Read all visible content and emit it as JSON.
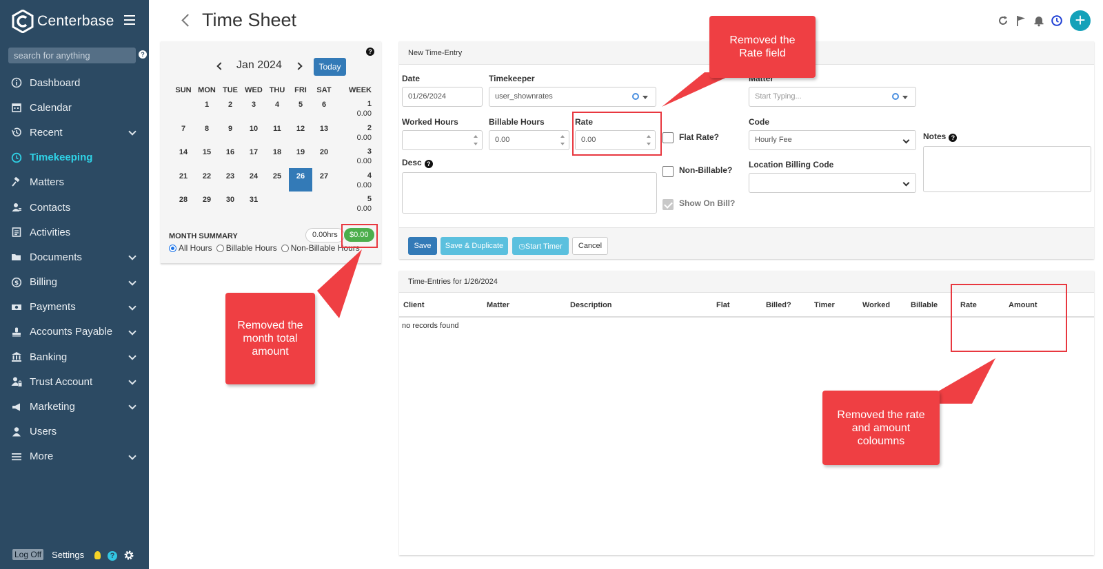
{
  "app": {
    "brand": "Centerbase",
    "search_placeholder": "search for anything",
    "help_glyph": "?",
    "logoff": "Log Off",
    "settings": "Settings",
    "accent": "#2fd2e6",
    "sidebar_bg": "#2c4a63"
  },
  "nav": [
    {
      "label": "Dashboard",
      "icon": "info-circle-icon",
      "chevron": false
    },
    {
      "label": "Calendar",
      "icon": "calendar-icon",
      "chevron": false
    },
    {
      "label": "Recent",
      "icon": "history-icon",
      "chevron": true
    },
    {
      "label": "Timekeeping",
      "icon": "clock-icon",
      "chevron": false,
      "active": true
    },
    {
      "label": "Matters",
      "icon": "gavel-icon",
      "chevron": false
    },
    {
      "label": "Contacts",
      "icon": "contacts-icon",
      "chevron": false
    },
    {
      "label": "Activities",
      "icon": "activities-icon",
      "chevron": false
    },
    {
      "label": "Documents",
      "icon": "folder-icon",
      "chevron": true
    },
    {
      "label": "Billing",
      "icon": "dollar-circle-icon",
      "chevron": true
    },
    {
      "label": "Payments",
      "icon": "money-icon",
      "chevron": true
    },
    {
      "label": "Accounts Payable",
      "icon": "stamp-icon",
      "chevron": true
    },
    {
      "label": "Banking",
      "icon": "bank-icon",
      "chevron": true
    },
    {
      "label": "Trust Account",
      "icon": "user-lock-icon",
      "chevron": true
    },
    {
      "label": "Marketing",
      "icon": "bullhorn-icon",
      "chevron": true
    },
    {
      "label": "Users",
      "icon": "user-icon",
      "chevron": false
    },
    {
      "label": "More",
      "icon": "menu-icon",
      "chevron": true
    }
  ],
  "page": {
    "title": "Time Sheet"
  },
  "calendar": {
    "month": "Jan 2024",
    "today_label": "Today",
    "headers": [
      "SUN",
      "MON",
      "TUE",
      "WED",
      "THU",
      "FRI",
      "SAT",
      "WEEK"
    ],
    "weeks": [
      {
        "days": [
          "",
          "1",
          "2",
          "3",
          "4",
          "5",
          "6"
        ],
        "wk": "1",
        "wk_hours": "0.00"
      },
      {
        "days": [
          "7",
          "8",
          "9",
          "10",
          "11",
          "12",
          "13"
        ],
        "wk": "2",
        "wk_hours": "0.00"
      },
      {
        "days": [
          "14",
          "15",
          "16",
          "17",
          "18",
          "19",
          "20"
        ],
        "wk": "3",
        "wk_hours": "0.00"
      },
      {
        "days": [
          "21",
          "22",
          "23",
          "24",
          "25",
          "26",
          "27"
        ],
        "wk": "4",
        "wk_hours": "0.00"
      },
      {
        "days": [
          "28",
          "29",
          "30",
          "31",
          "",
          "",
          ""
        ],
        "wk": "5",
        "wk_hours": "0.00"
      }
    ],
    "selected_day": "26",
    "month_summary_label": "MONTH SUMMARY",
    "hours_badge": "0.00hrs",
    "amount_badge": "$0.00",
    "filters": [
      "All Hours",
      "Billable Hours",
      "Non-Billable Hours"
    ],
    "filter_selected": "All Hours"
  },
  "entry": {
    "header": "New Time-Entry",
    "date_label": "Date",
    "date_value": "01/26/2024",
    "timekeeper_label": "Timekeeper",
    "timekeeper_value": "user_shownrates",
    "matter_label": "Matter",
    "matter_placeholder": "Start Typing...",
    "worked_label": "Worked Hours",
    "worked_value": "",
    "billable_label": "Billable Hours",
    "billable_value": "0.00",
    "rate_label": "Rate",
    "rate_value": "0.00",
    "flat_label": "Flat Rate?",
    "nonbill_label": "Non-Billable?",
    "show_label": "Show On Bill?",
    "code_label": "Code",
    "code_value": "Hourly Fee",
    "loc_label": "Location Billing Code",
    "loc_value": "",
    "notes_label": "Notes",
    "desc_label": "Desc",
    "save": "Save",
    "save_dup": "Save & Duplicate",
    "start_timer": "Start Timer",
    "cancel": "Cancel"
  },
  "list": {
    "header": "Time-Entries for 1/26/2024",
    "columns": [
      "Client",
      "Matter",
      "Description",
      "Flat",
      "Billed?",
      "Timer",
      "Worked",
      "Billable",
      "Rate",
      "Amount"
    ],
    "empty": "no records found"
  },
  "annotations": {
    "rate": "Removed the Rate field",
    "month": "Removed the month total amount",
    "cols": "Removed the rate and amount coloumns",
    "color": "#ef3f43"
  }
}
